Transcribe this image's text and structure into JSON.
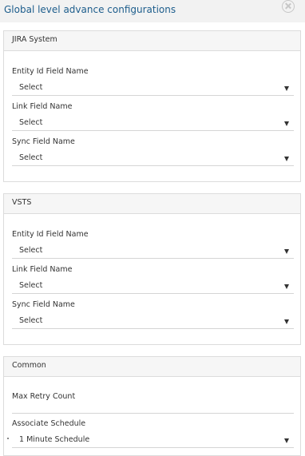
{
  "dialog": {
    "title": "Global level advance configurations",
    "close_icon": "close-circle-icon"
  },
  "panels": [
    {
      "title": "JIRA System",
      "fields": [
        {
          "label": "Entity Id Field Name",
          "value": "Select"
        },
        {
          "label": "Link Field Name",
          "value": "Select"
        },
        {
          "label": "Sync Field Name",
          "value": "Select"
        }
      ]
    },
    {
      "title": "VSTS",
      "fields": [
        {
          "label": "Entity Id Field Name",
          "value": "Select"
        },
        {
          "label": "Link Field Name",
          "value": "Select"
        },
        {
          "label": "Sync Field Name",
          "value": "Select"
        }
      ]
    },
    {
      "title": "Common",
      "fields": [
        {
          "label": "Max Retry Count",
          "value": ""
        },
        {
          "label": "Associate Schedule",
          "value": "1 Minute Schedule"
        }
      ]
    }
  ],
  "icons": {
    "dropdown": "caret-down-icon"
  },
  "colors": {
    "title": "#1d5d8c",
    "header_bg": "#f2f2f2",
    "panel_header_bg": "#f6f6f6",
    "border": "#dcdcdc"
  }
}
